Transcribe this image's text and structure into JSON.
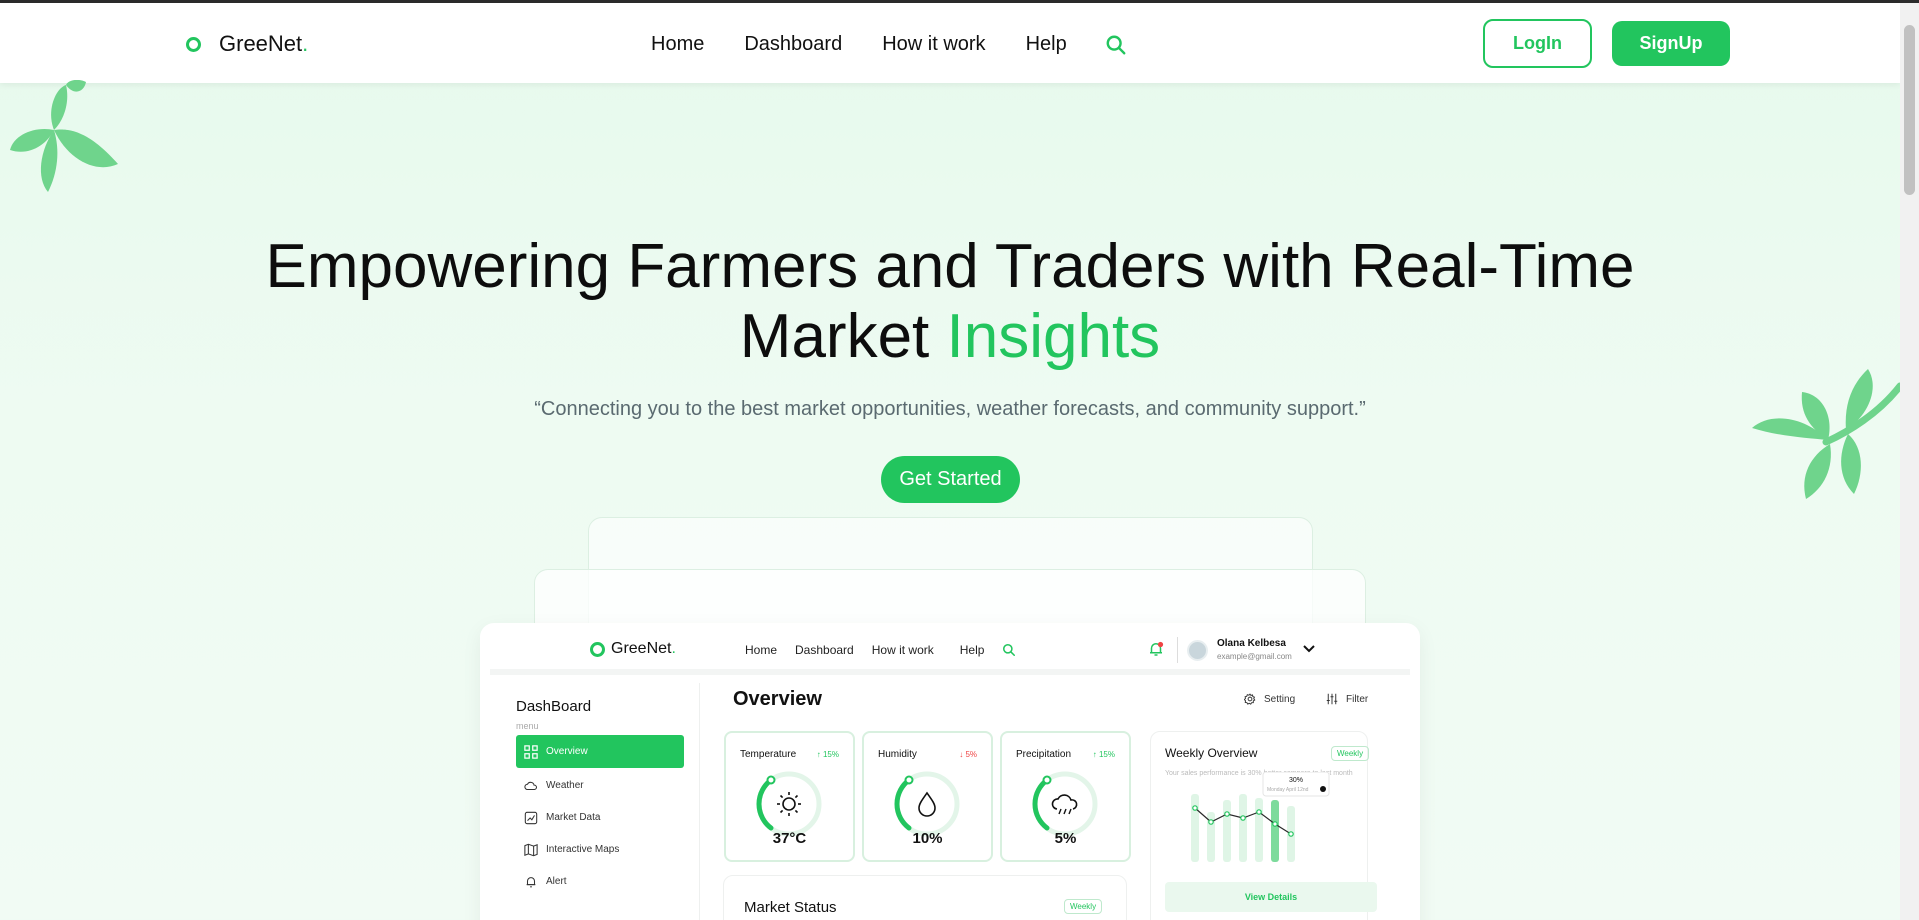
{
  "nav": {
    "brand": "GreeNet",
    "brand_suffix": ".",
    "links": [
      "Home",
      "Dashboard",
      "How it work",
      "Help"
    ],
    "search_icon": "search-icon",
    "login": "LogIn",
    "signup": "SignUp"
  },
  "hero": {
    "title_main": "Empowering Farmers and Traders with Real-Time Market ",
    "title_accent": "Insights",
    "subtitle": "“Connecting you to the best market opportunities, weather forecasts, and community support.”",
    "cta": "Get Started"
  },
  "preview": {
    "brand": "GreeNet",
    "brand_suffix": ".",
    "links": [
      "Home",
      "Dashboard",
      "How it work",
      "Help"
    ],
    "user_name": "Olana Kelbesa",
    "user_email": "example@gmail.com",
    "sidebar": {
      "title": "DashBoard",
      "menu_label": "menu",
      "items": [
        "Overview",
        "Weather",
        "Market Data",
        "Interactive Maps",
        "Alert"
      ]
    },
    "overview_title": "Overview",
    "setting": "Setting",
    "filter": "Filter",
    "metrics": [
      {
        "label": "Temperature",
        "change": "15%",
        "direction": "up",
        "value": "37°C",
        "icon": "sun-icon"
      },
      {
        "label": "Humidity",
        "change": "5%",
        "direction": "down",
        "value": "10%",
        "icon": "droplet-icon"
      },
      {
        "label": "Precipitation",
        "change": "15%",
        "direction": "up",
        "value": "5%",
        "icon": "rain-cloud-icon"
      }
    ],
    "weekly": {
      "title": "Weekly Overview",
      "badge": "Weekly",
      "subtitle": "Your sales performance is 30% better compare to last month",
      "tooltip_value": "30%",
      "tooltip_date": "Monday April 12nd",
      "view_details": "View Details"
    },
    "market": {
      "title": "Market Status",
      "badge": "Weekly"
    }
  },
  "colors": {
    "accent": "#22c55e",
    "background": "#e6f9ec",
    "leaf": "#6fd48c"
  }
}
